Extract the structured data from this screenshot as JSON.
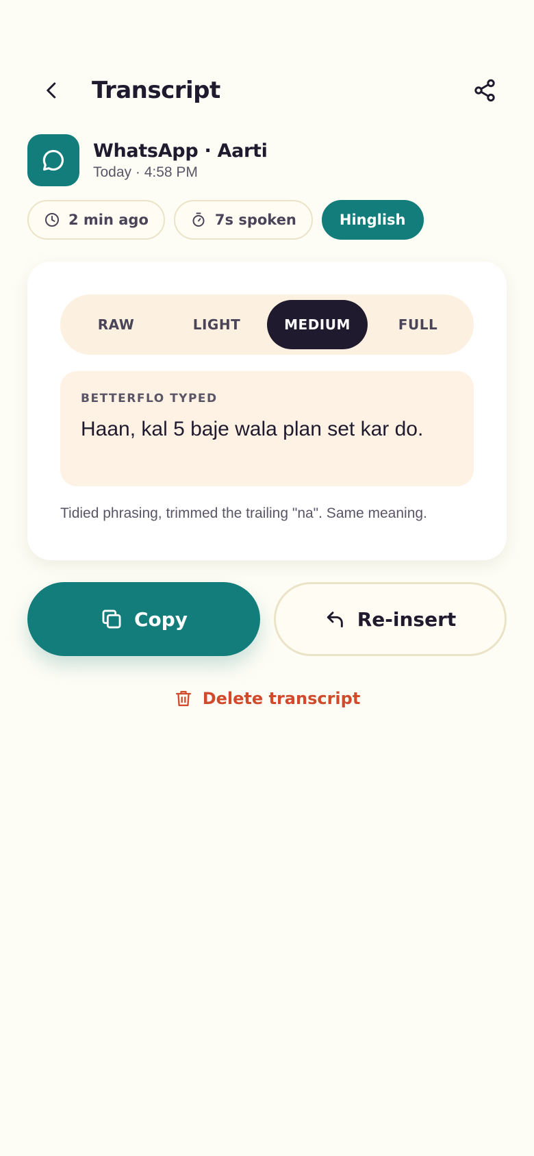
{
  "header": {
    "title": "Transcript",
    "back_icon": "chevron-left-icon",
    "share_icon": "share-icon"
  },
  "app": {
    "name": "WhatsApp · Aarti",
    "time": "Today · 4:58 PM",
    "icon": "chat-bubble-icon"
  },
  "chips": {
    "ago": "2 min ago",
    "spoken": "7s spoken",
    "language": "Hinglish"
  },
  "levels": {
    "options": [
      "RAW",
      "LIGHT",
      "MEDIUM",
      "FULL"
    ],
    "selected": "MEDIUM"
  },
  "typed": {
    "label": "BETTERFLO TYPED",
    "text": "Haan, kal 5 baje wala plan set kar do."
  },
  "note": "Tidied phrasing, trimmed the trailing \"na\". Same meaning.",
  "actions": {
    "copy_label": "Copy",
    "reinsert_label": "Re-insert",
    "delete_label": "Delete transcript"
  },
  "colors": {
    "accent": "#127d7a",
    "dark": "#1f1a2e",
    "danger": "#d24a2c",
    "background": "#fefdf5"
  }
}
